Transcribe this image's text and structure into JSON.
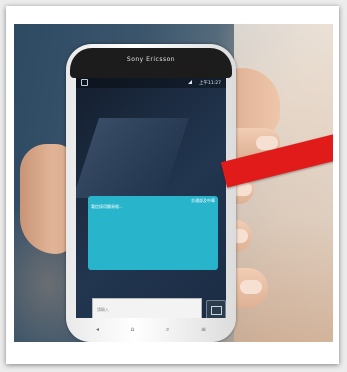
{
  "phone": {
    "brand": "Sony Ericsson",
    "status_time": "上午11:27"
  },
  "message": {
    "meta": "",
    "lines": [
      "",
      "",
      "",
      ""
    ],
    "highlight": "交通部及中華",
    "last_line": "電信採用簡易格..."
  },
  "input": {
    "placeholder": "請輸入"
  },
  "navbar_icons": [
    "back-icon",
    "home-icon",
    "search-icon",
    "menu-icon"
  ],
  "colors": {
    "arrow": "#e11a1a",
    "bubble": "#28b5cc"
  }
}
